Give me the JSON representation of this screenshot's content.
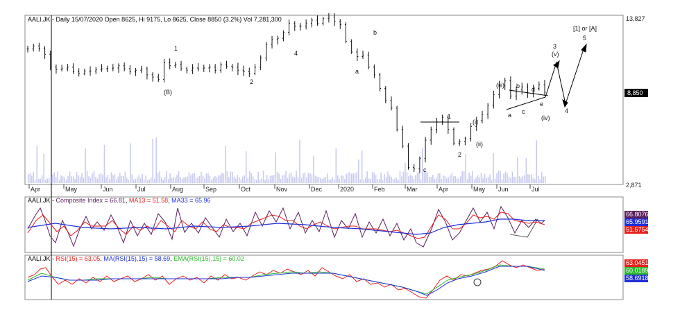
{
  "chart_data": [
    {
      "type": "ohlc",
      "title": "AALI.JK - Daily 15/07/2020 Open 8625, Hi 9175, Lo 8625, Close 8850 (3.2%) Vol 7,281,300",
      "x_ticks": [
        "Apr",
        "May",
        "Jun",
        "Jul",
        "Aug",
        "Sep",
        "Oct",
        "Nov",
        "Dec",
        "2020",
        "Feb",
        "Mar",
        "Apr",
        "May",
        "Jun",
        "Jul"
      ],
      "y_ticks": [
        "13,827",
        "2,871"
      ],
      "last_price_label": "8,850",
      "ylim": [
        2871,
        13827
      ],
      "series": [
        {
          "values": [
            11700,
            11900,
            11750,
            11350,
            10500,
            10350,
            10400,
            10500,
            10200,
            10100,
            10250,
            10250,
            10350,
            10400,
            10400,
            10450,
            10600,
            10400,
            10200,
            10300,
            10400,
            10000,
            9850,
            9700,
            10800,
            10600,
            10700,
            10400,
            10300,
            10450,
            10400,
            10450,
            10500,
            10300,
            10650,
            10550,
            10500,
            10300,
            10200,
            10100,
            10500,
            11100,
            12000,
            12300,
            12400,
            12800,
            13400,
            13200,
            13200,
            13400,
            13600,
            13400,
            13700,
            13800,
            13500,
            13300,
            12200,
            11500,
            11200,
            11300,
            10500,
            10000,
            9100,
            8300,
            7800,
            6400,
            5300,
            3900,
            3800,
            4500,
            5700,
            6400,
            6900,
            7200,
            6400,
            5500,
            5600,
            5800,
            6600,
            7000,
            7400,
            8000,
            8700,
            9300,
            9600,
            8600,
            9000,
            9200,
            8800,
            9100,
            9350,
            8850
          ]
        }
      ]
    },
    {
      "type": "line",
      "title": "AALI.JK - Composite Index = 66.81, MA13 = 51.58, MA33 = 65.96",
      "series": [
        {
          "name": "Composite Index",
          "color": "#5a1f5e",
          "last_label": "66.8076"
        },
        {
          "name": "MA13",
          "color": "#e8201c",
          "last_label": "51.5754"
        },
        {
          "name": "MA33",
          "color": "#1f2fd8",
          "last_label": "65.9591"
        }
      ]
    },
    {
      "type": "line",
      "title": "AALI.JK - RSI(15) = 63.05, MA(RSI(15),15) = 58.69, EMA(RSI(15),15) = 60.02",
      "series": [
        {
          "name": "RSI(15)",
          "color": "#e8201c",
          "last_label": "63.0451"
        },
        {
          "name": "MA(RSI(15),15)",
          "color": "#1f2fd8",
          "last_label": "58.6918"
        },
        {
          "name": "EMA(RSI(15),15)",
          "color": "#2cb82c",
          "last_label": "60.0189"
        }
      ]
    }
  ],
  "annotations": {
    "wave_1": "1",
    "wave_2": "2",
    "wave_3": "3",
    "wave_4": "4",
    "wave_B": "(B)",
    "wave_a": "a",
    "wave_b": "b",
    "wave_c": "c",
    "wave_1b": "1",
    "wave_2b": "2",
    "wave_i": "(i)",
    "wave_ii": "(ii)",
    "wave_iii": "(iii)",
    "wave_iv": "(iv)",
    "wave_v": "(v)",
    "wave_3b": "3",
    "wave_4b": "4",
    "wave_5": "5",
    "tri_a": "a",
    "tri_b": "b",
    "tri_c": "c",
    "tri_d": "d",
    "tri_e": "e",
    "wave_1_or_A": "[1] or [A]"
  },
  "header_main": {
    "symbol": "AALI.JK - ",
    "text": "Daily 15/07/2020 Open 8625, Hi 9175, Lo 8625, Close 8850 (3.2%) Vol 7,281,300"
  },
  "header_ci": {
    "symbol": "AALI.JK - ",
    "ci": "Composite Index = 66.81",
    "ma13": "MA13 = 51.58",
    "ma33": "MA33 = 65.96"
  },
  "header_rsi": {
    "symbol": "AALI.JK - ",
    "rsi": "RSI(15) = 63.05",
    "ma": "MA(RSI(15),15) = 58.69",
    "ema": "EMA(RSI(15),15) = 60.02"
  }
}
